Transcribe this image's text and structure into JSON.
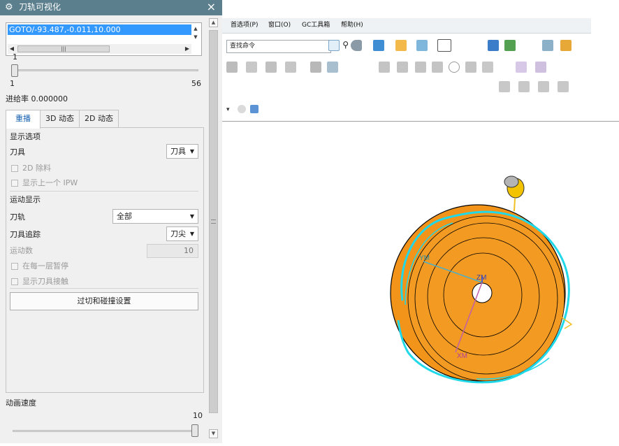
{
  "dialog": {
    "title": "刀轨可视化",
    "close_glyph": "×",
    "path_list": {
      "selected_item": "GOTO/-93.487,-0.011,10.000"
    },
    "frame_slider": {
      "current": "1",
      "min": "1",
      "max": "56",
      "position_fraction": 0.0
    },
    "feed_rate_text": "进给率 0.000000",
    "tabs": [
      {
        "label": "重播",
        "active": true
      },
      {
        "label": "3D 动态",
        "active": false
      },
      {
        "label": "2D 动态",
        "active": false
      }
    ],
    "display_options": {
      "section_label": "显示选项",
      "tool_label": "刀具",
      "tool_value": "刀具",
      "remove_2d_label": "2D 除料",
      "show_prev_ipw_label": "显示上一个 IPW"
    },
    "motion_display": {
      "section_label": "运动显示",
      "toolpath_label": "刀轨",
      "toolpath_value": "全部",
      "tool_trace_label": "刀具追踪",
      "tool_trace_value": "刀尖",
      "motion_count_label": "运动数",
      "motion_count_value": "10",
      "pause_each_layer_label": "在每一层暂停",
      "show_tool_contact_label": "显示刀具接触"
    },
    "gouge_button_label": "过切和碰撞设置",
    "animation_speed": {
      "label": "动画速度",
      "value": "10",
      "position_fraction": 1.0
    }
  },
  "menubar": {
    "items": [
      "首选项(P)",
      "窗口(O)",
      "GC工具箱",
      "帮助(H)"
    ]
  },
  "toolbar": {
    "search_value": "查找命令"
  },
  "viewport": {
    "axis_labels": {
      "ym": "YM",
      "zm": "ZM",
      "xm": "XM"
    },
    "colors": {
      "part": "#f2941a",
      "toolpath": "#20d8e8",
      "ym_axis": "#4ab0c8",
      "xm_axis": "#c060a8"
    }
  }
}
